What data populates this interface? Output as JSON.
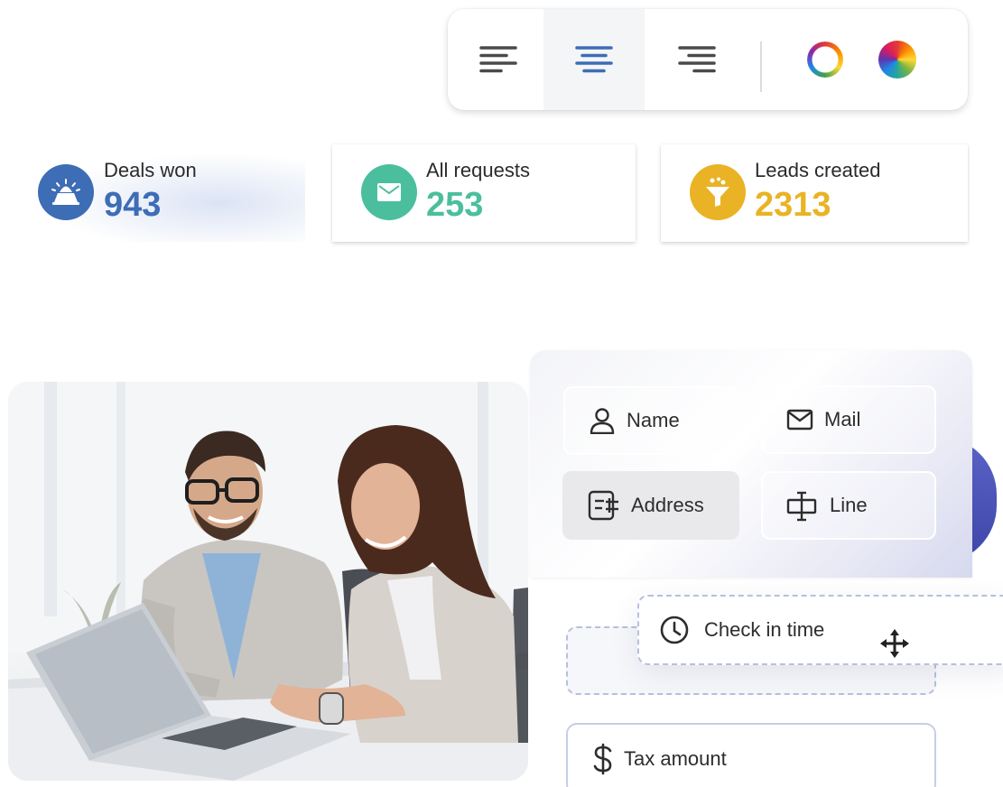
{
  "toolbar": {
    "items": [
      {
        "name": "align-left",
        "icon": "align-left-icon",
        "active": false
      },
      {
        "name": "align-center",
        "icon": "align-center-icon",
        "active": true
      },
      {
        "name": "align-right",
        "icon": "align-right-icon",
        "active": false
      }
    ],
    "colors": [
      {
        "icon": "color-ring-icon"
      },
      {
        "icon": "color-wheel-icon"
      }
    ],
    "accent_color": "#3d6db5"
  },
  "stats": [
    {
      "label": "Deals won",
      "value": "943",
      "icon": "trophy-icon",
      "color": "#3d6db5"
    },
    {
      "label": "All requests",
      "value": "253",
      "icon": "envelope-icon",
      "color": "#4bbf9d"
    },
    {
      "label": "Leads created",
      "value": "2313",
      "icon": "funnel-icon",
      "color": "#e9b325"
    }
  ],
  "form": {
    "fields": [
      {
        "label": "Name",
        "icon": "user-icon"
      },
      {
        "label": "Mail",
        "icon": "mail-icon"
      },
      {
        "label": "Address",
        "icon": "address-icon"
      },
      {
        "label": "Line",
        "icon": "text-cursor-icon"
      }
    ],
    "dragging_field": {
      "label": "Check in time",
      "icon": "clock-icon",
      "handle_icon": "move-icon"
    },
    "tax_field": {
      "label": "Tax amount",
      "icon": "dollar-icon"
    }
  },
  "photo": {
    "alt": "business-people-laptop-photo"
  }
}
